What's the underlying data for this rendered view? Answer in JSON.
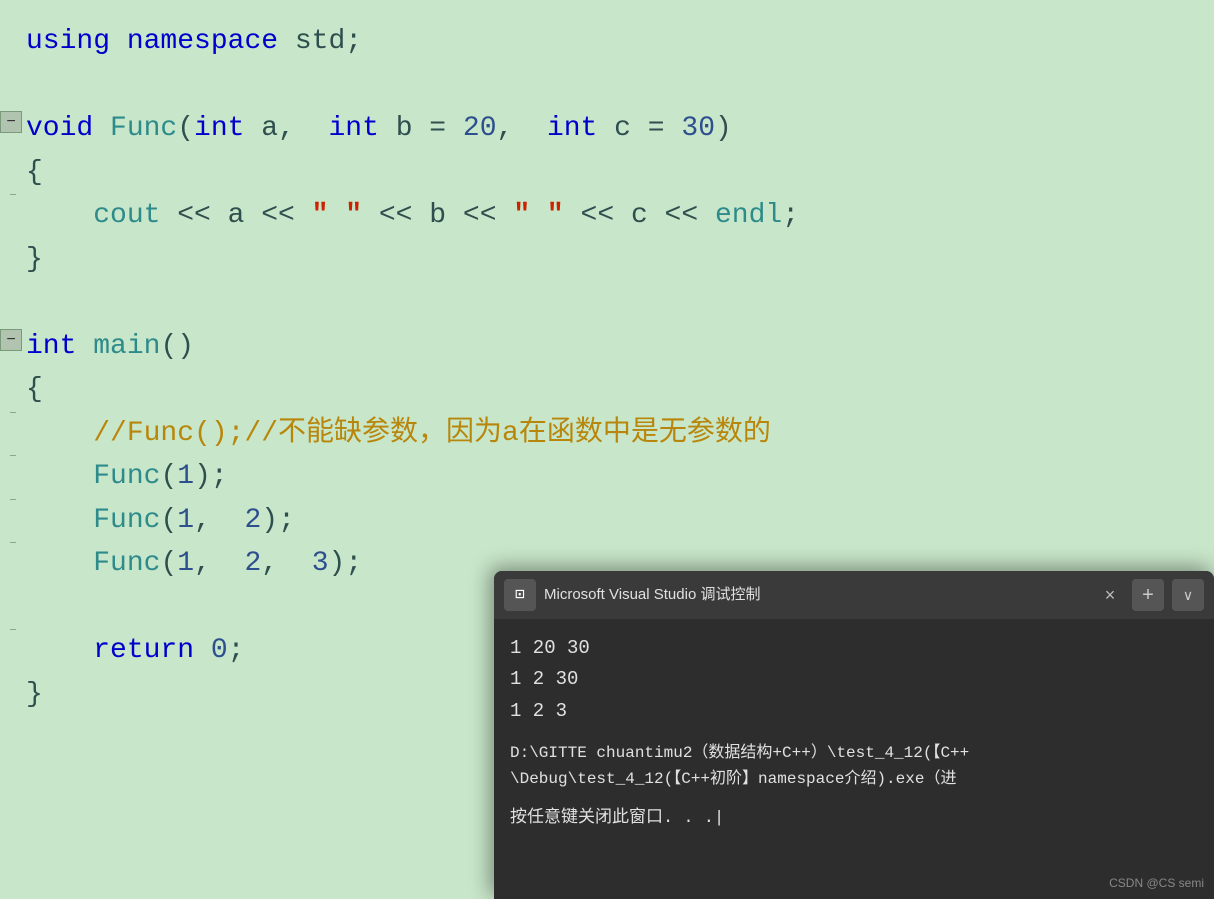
{
  "code": {
    "line1": "using namespace std;",
    "line2_void": "void",
    "line2_func": "Func",
    "line2_params": "(int a,  int b = 20,  int c = 30)",
    "line3_open": "{",
    "line4_cout": "    cout << a << \" \" << b << \" \" << c << endl;",
    "line5_close": "}",
    "line6_int": "int",
    "line6_main": "main()",
    "line7_open": "{",
    "line8_comment": "    //Func();//不能缺参数，因为a在函数中是无参数的",
    "line9_func1": "    Func(1);",
    "line10_func2": "    Func(1,  2);",
    "line11_func3": "    Func(1,  2,  3);",
    "line12_return": "    return 0;",
    "line13_close": "}"
  },
  "terminal": {
    "title": "Microsoft Visual Studio 调试控制",
    "icon": "⊡",
    "output_line1": "1 20 30",
    "output_line2": "1 2 30",
    "output_line3": "1 2 3",
    "path_line1": "D:\\GITTE chuantimu2（数据结构+C++）\\test_4_12(【C++",
    "path_line2": "\\Debug\\test_4_12(【C++初阶】namespace介绍).exe（进",
    "prompt": "按任意键关闭此窗口. . .",
    "close_label": "×",
    "plus_label": "+",
    "chevron_label": "∨"
  },
  "attribution": "CSDN @CS semi"
}
